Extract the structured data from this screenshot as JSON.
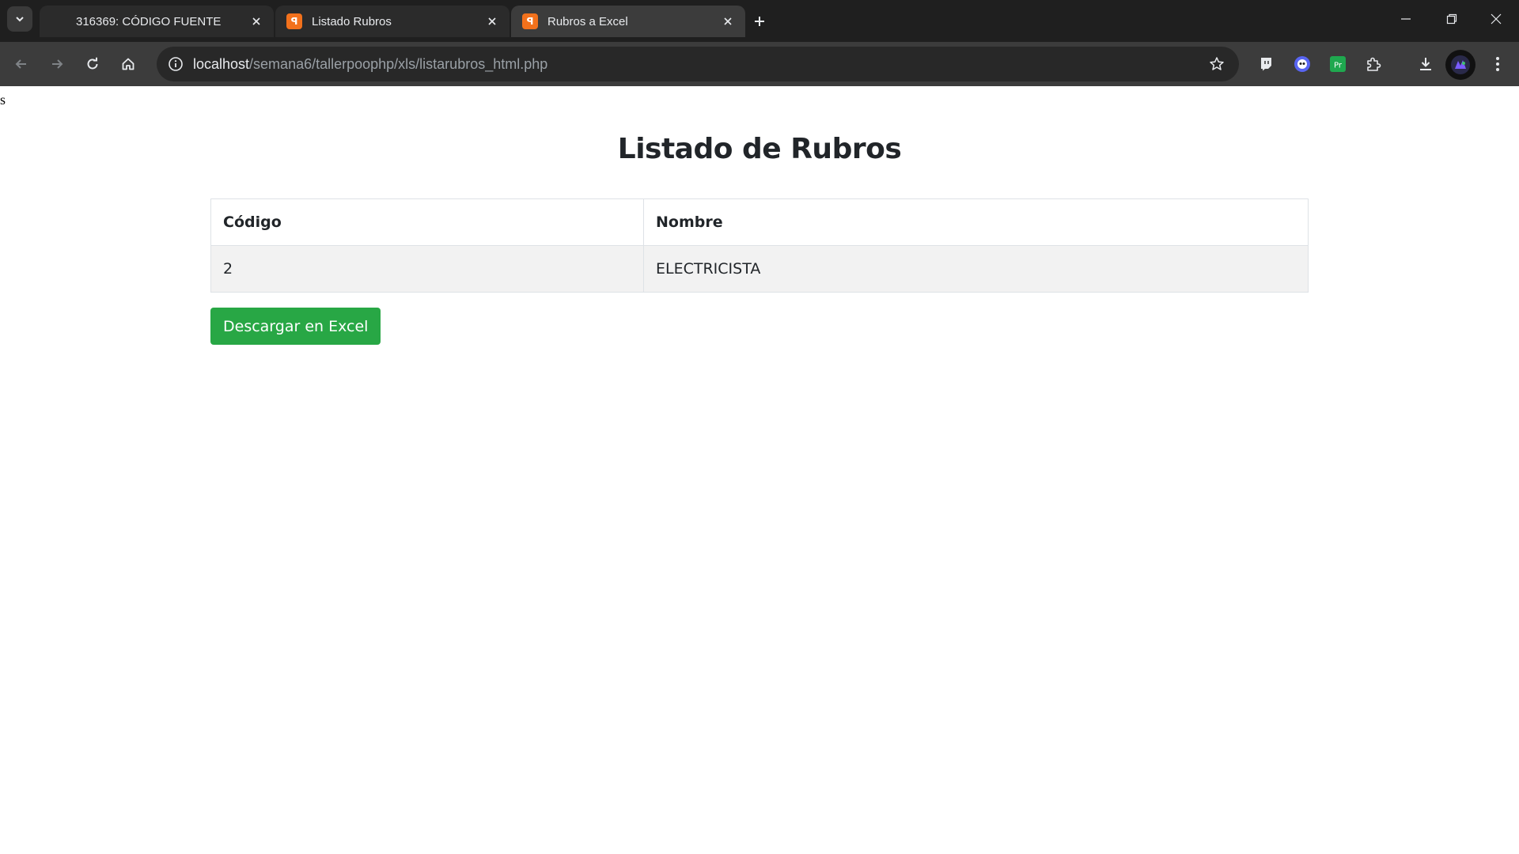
{
  "tabs": [
    {
      "title": "316369: CÓDIGO FUENTE",
      "active": false,
      "icon": "blank-icon"
    },
    {
      "title": "Listado Rubros",
      "active": false,
      "icon": "xampp-icon"
    },
    {
      "title": "Rubros a Excel",
      "active": true,
      "icon": "xampp-icon"
    }
  ],
  "address": {
    "host": "localhost",
    "path": "/semana6/tallerpoophp/xls/listarubros_html.php"
  },
  "page": {
    "stray_text": "s",
    "title": "Listado de Rubros",
    "table": {
      "headers": [
        "Código",
        "Nombre"
      ],
      "rows": [
        [
          "2",
          "ELECTRICISTA"
        ]
      ]
    },
    "download_button": "Descargar en Excel"
  },
  "colors": {
    "accent_green": "#28a745",
    "tab_bar": "#1f1f1f",
    "toolbar": "#3c3c3c"
  }
}
